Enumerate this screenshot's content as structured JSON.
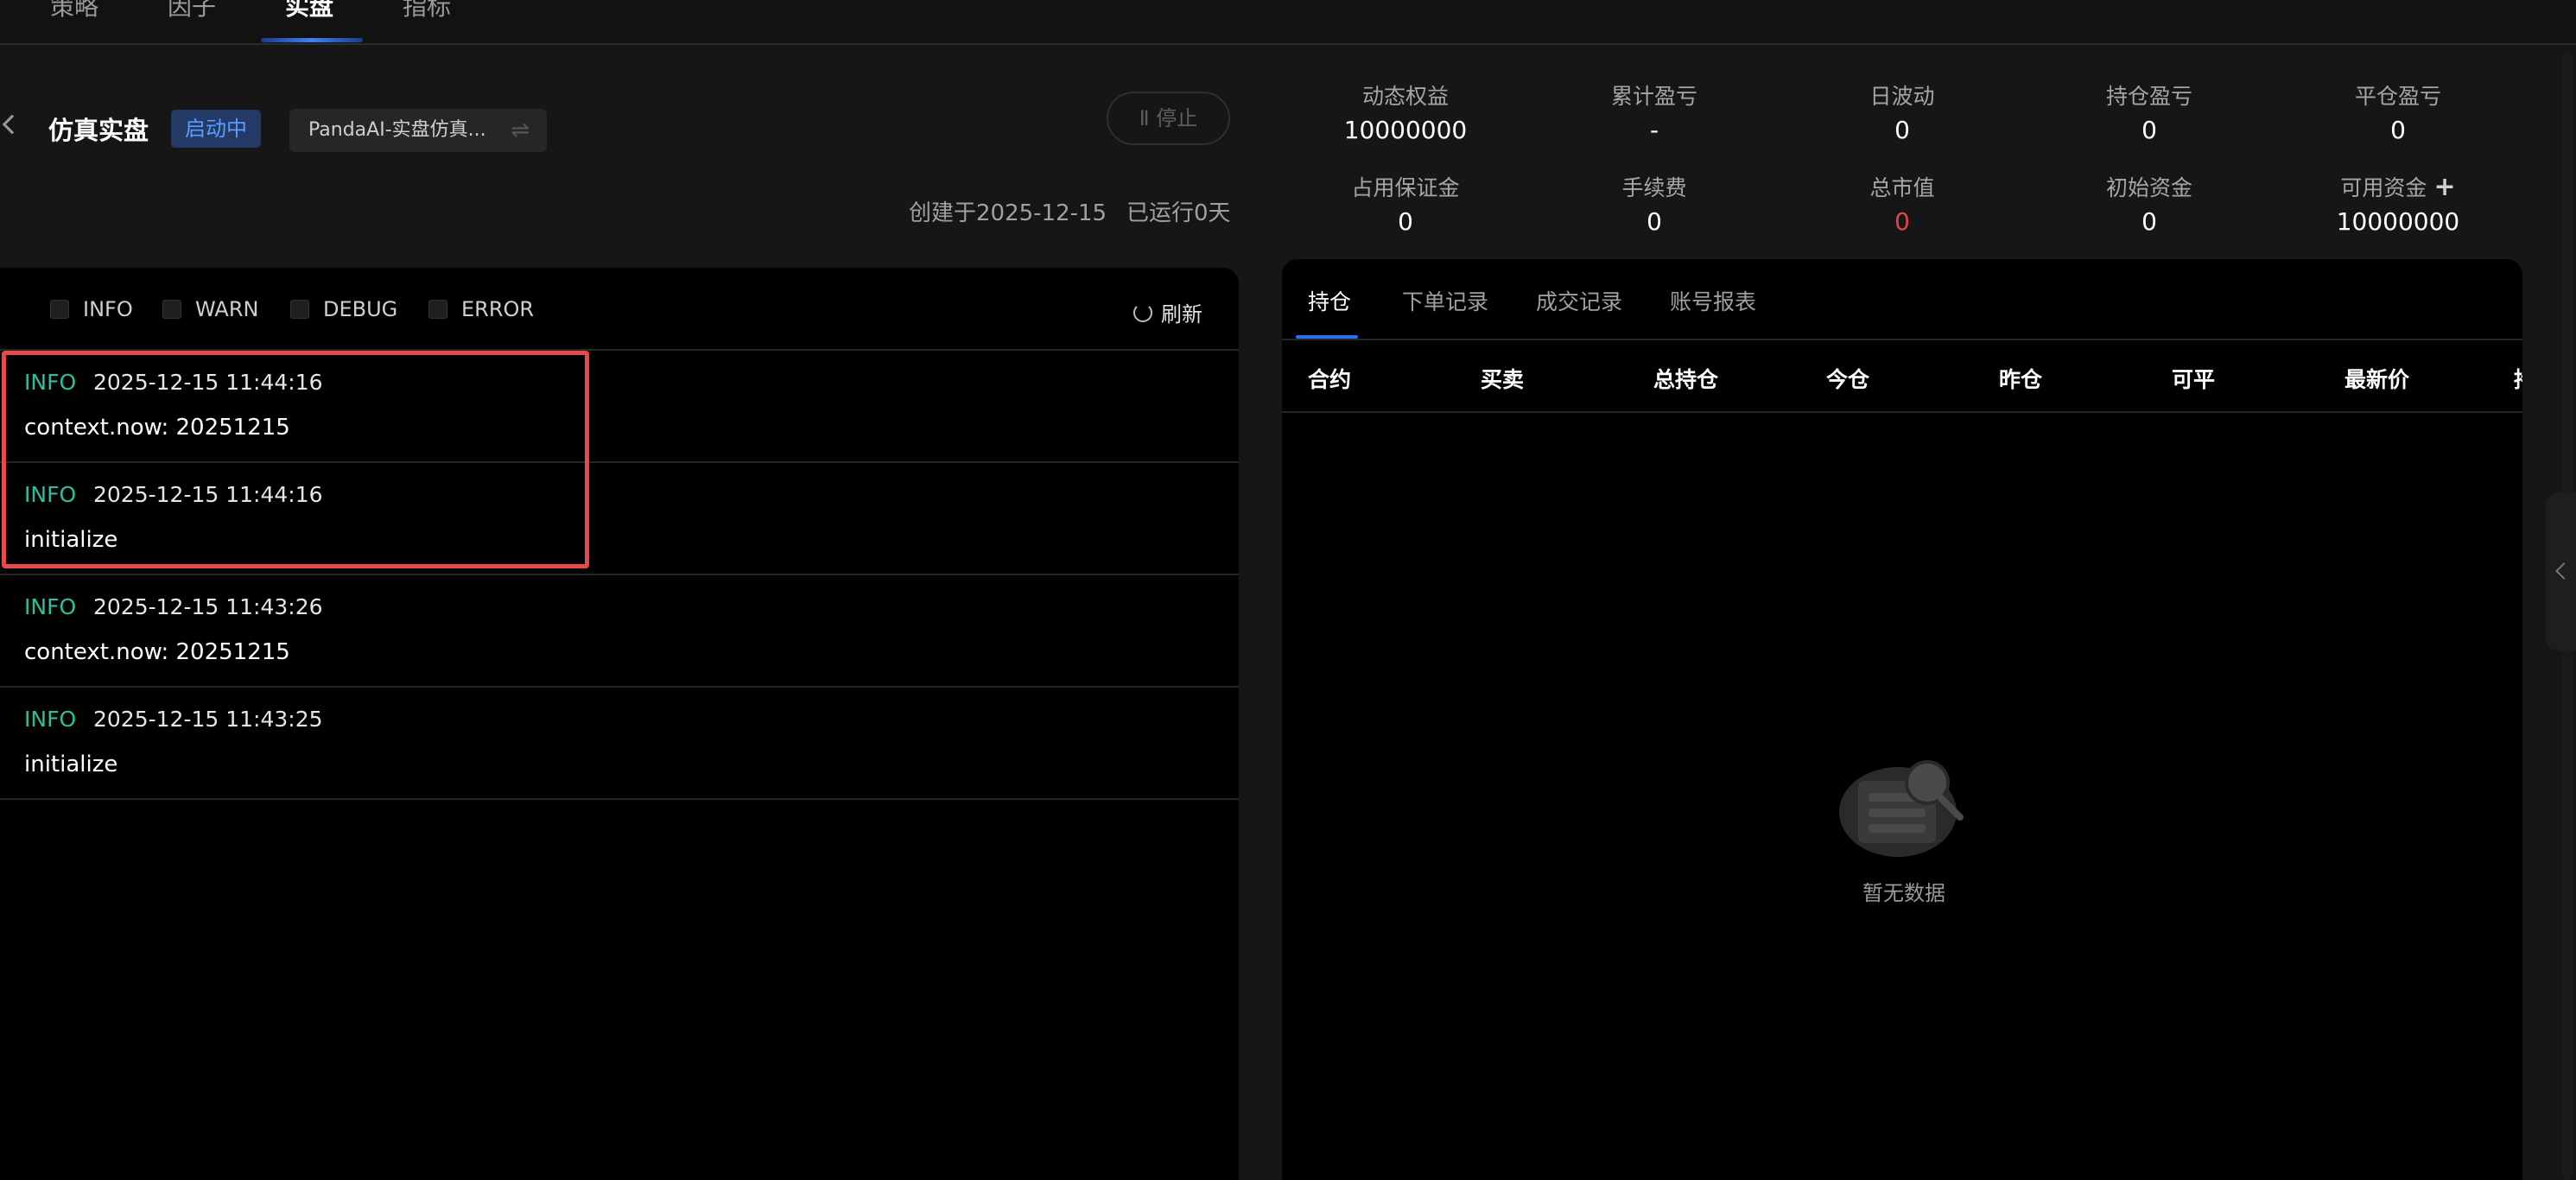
{
  "nav": {
    "tabs": [
      {
        "label": "策略"
      },
      {
        "label": "因子"
      },
      {
        "label": "实盘"
      },
      {
        "label": "指标"
      }
    ]
  },
  "header": {
    "title": "仿真实盘",
    "status": "启动中",
    "strategy": "PandaAI-实盘仿真...",
    "stop_label": "停止",
    "created": "创建于2025-12-15",
    "running": "已运行0天"
  },
  "logs": {
    "filters": [
      "INFO",
      "WARN",
      "DEBUG",
      "ERROR"
    ],
    "refresh_label": "刷新",
    "entries": [
      {
        "level": "INFO",
        "time": "2025-12-15 11:44:16",
        "message": "context.now: 20251215"
      },
      {
        "level": "INFO",
        "time": "2025-12-15 11:44:16",
        "message": "initialize"
      },
      {
        "level": "INFO",
        "time": "2025-12-15 11:43:26",
        "message": "context.now: 20251215"
      },
      {
        "level": "INFO",
        "time": "2025-12-15 11:43:25",
        "message": "initialize"
      }
    ]
  },
  "metrics": [
    {
      "label": "动态权益",
      "value": "10000000"
    },
    {
      "label": "累计盈亏",
      "value": "-"
    },
    {
      "label": "日波动",
      "value": "0"
    },
    {
      "label": "持仓盈亏",
      "value": "0"
    },
    {
      "label": "平仓盈亏",
      "value": "0"
    },
    {
      "label": "占用保证金",
      "value": "0"
    },
    {
      "label": "手续费",
      "value": "0"
    },
    {
      "label": "总市值",
      "value": "0"
    },
    {
      "label": "初始资金",
      "value": "0"
    },
    {
      "label": "可用资金",
      "value": "10000000"
    }
  ],
  "metric_colors": {
    "total_market_value": "#e2443f"
  },
  "positions": {
    "tabs": [
      "持仓",
      "下单记录",
      "成交记录",
      "账号报表"
    ],
    "columns": [
      "合约",
      "买卖",
      "总持仓",
      "今仓",
      "昨仓",
      "可平",
      "最新价",
      "持"
    ],
    "empty_text": "暂无数据"
  }
}
